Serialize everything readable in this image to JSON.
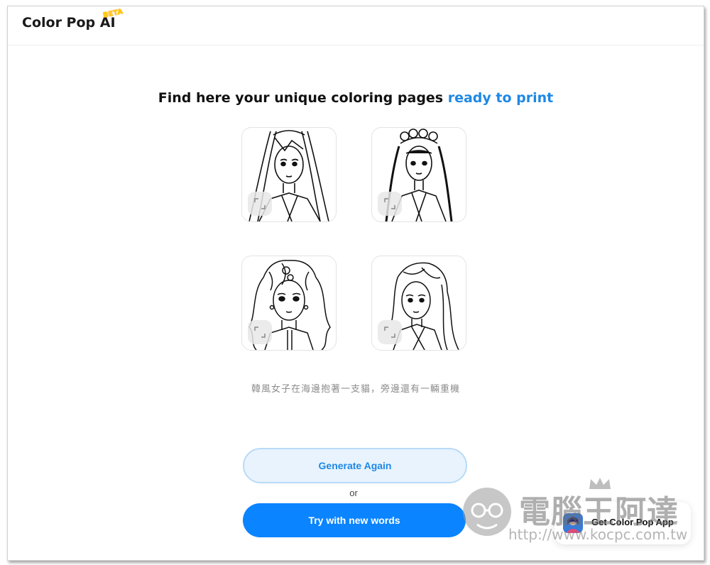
{
  "app": {
    "logo": "Color Pop AI",
    "badge": "BETA"
  },
  "main": {
    "headline_prefix": "Find here your unique coloring pages ",
    "headline_highlight": "ready to print",
    "prompt_caption": "韓風女子在海邊抱著一支貓，旁邊還有一輛重機",
    "images": [
      {
        "label": "coloring-page-1"
      },
      {
        "label": "coloring-page-2"
      },
      {
        "label": "coloring-page-3"
      },
      {
        "label": "coloring-page-4"
      }
    ]
  },
  "actions": {
    "generate_again": "Generate Again",
    "or": "or",
    "try_new_words": "Try with new words"
  },
  "promo": {
    "get_app": "Get Color Pop App"
  },
  "watermark": {
    "name": "電腦王阿達",
    "url": "http://www.kocpc.com.tw"
  },
  "colors": {
    "accent": "#1e88e5",
    "primary_button": "#0a84ff",
    "secondary_button_bg": "#e8f3fd"
  }
}
